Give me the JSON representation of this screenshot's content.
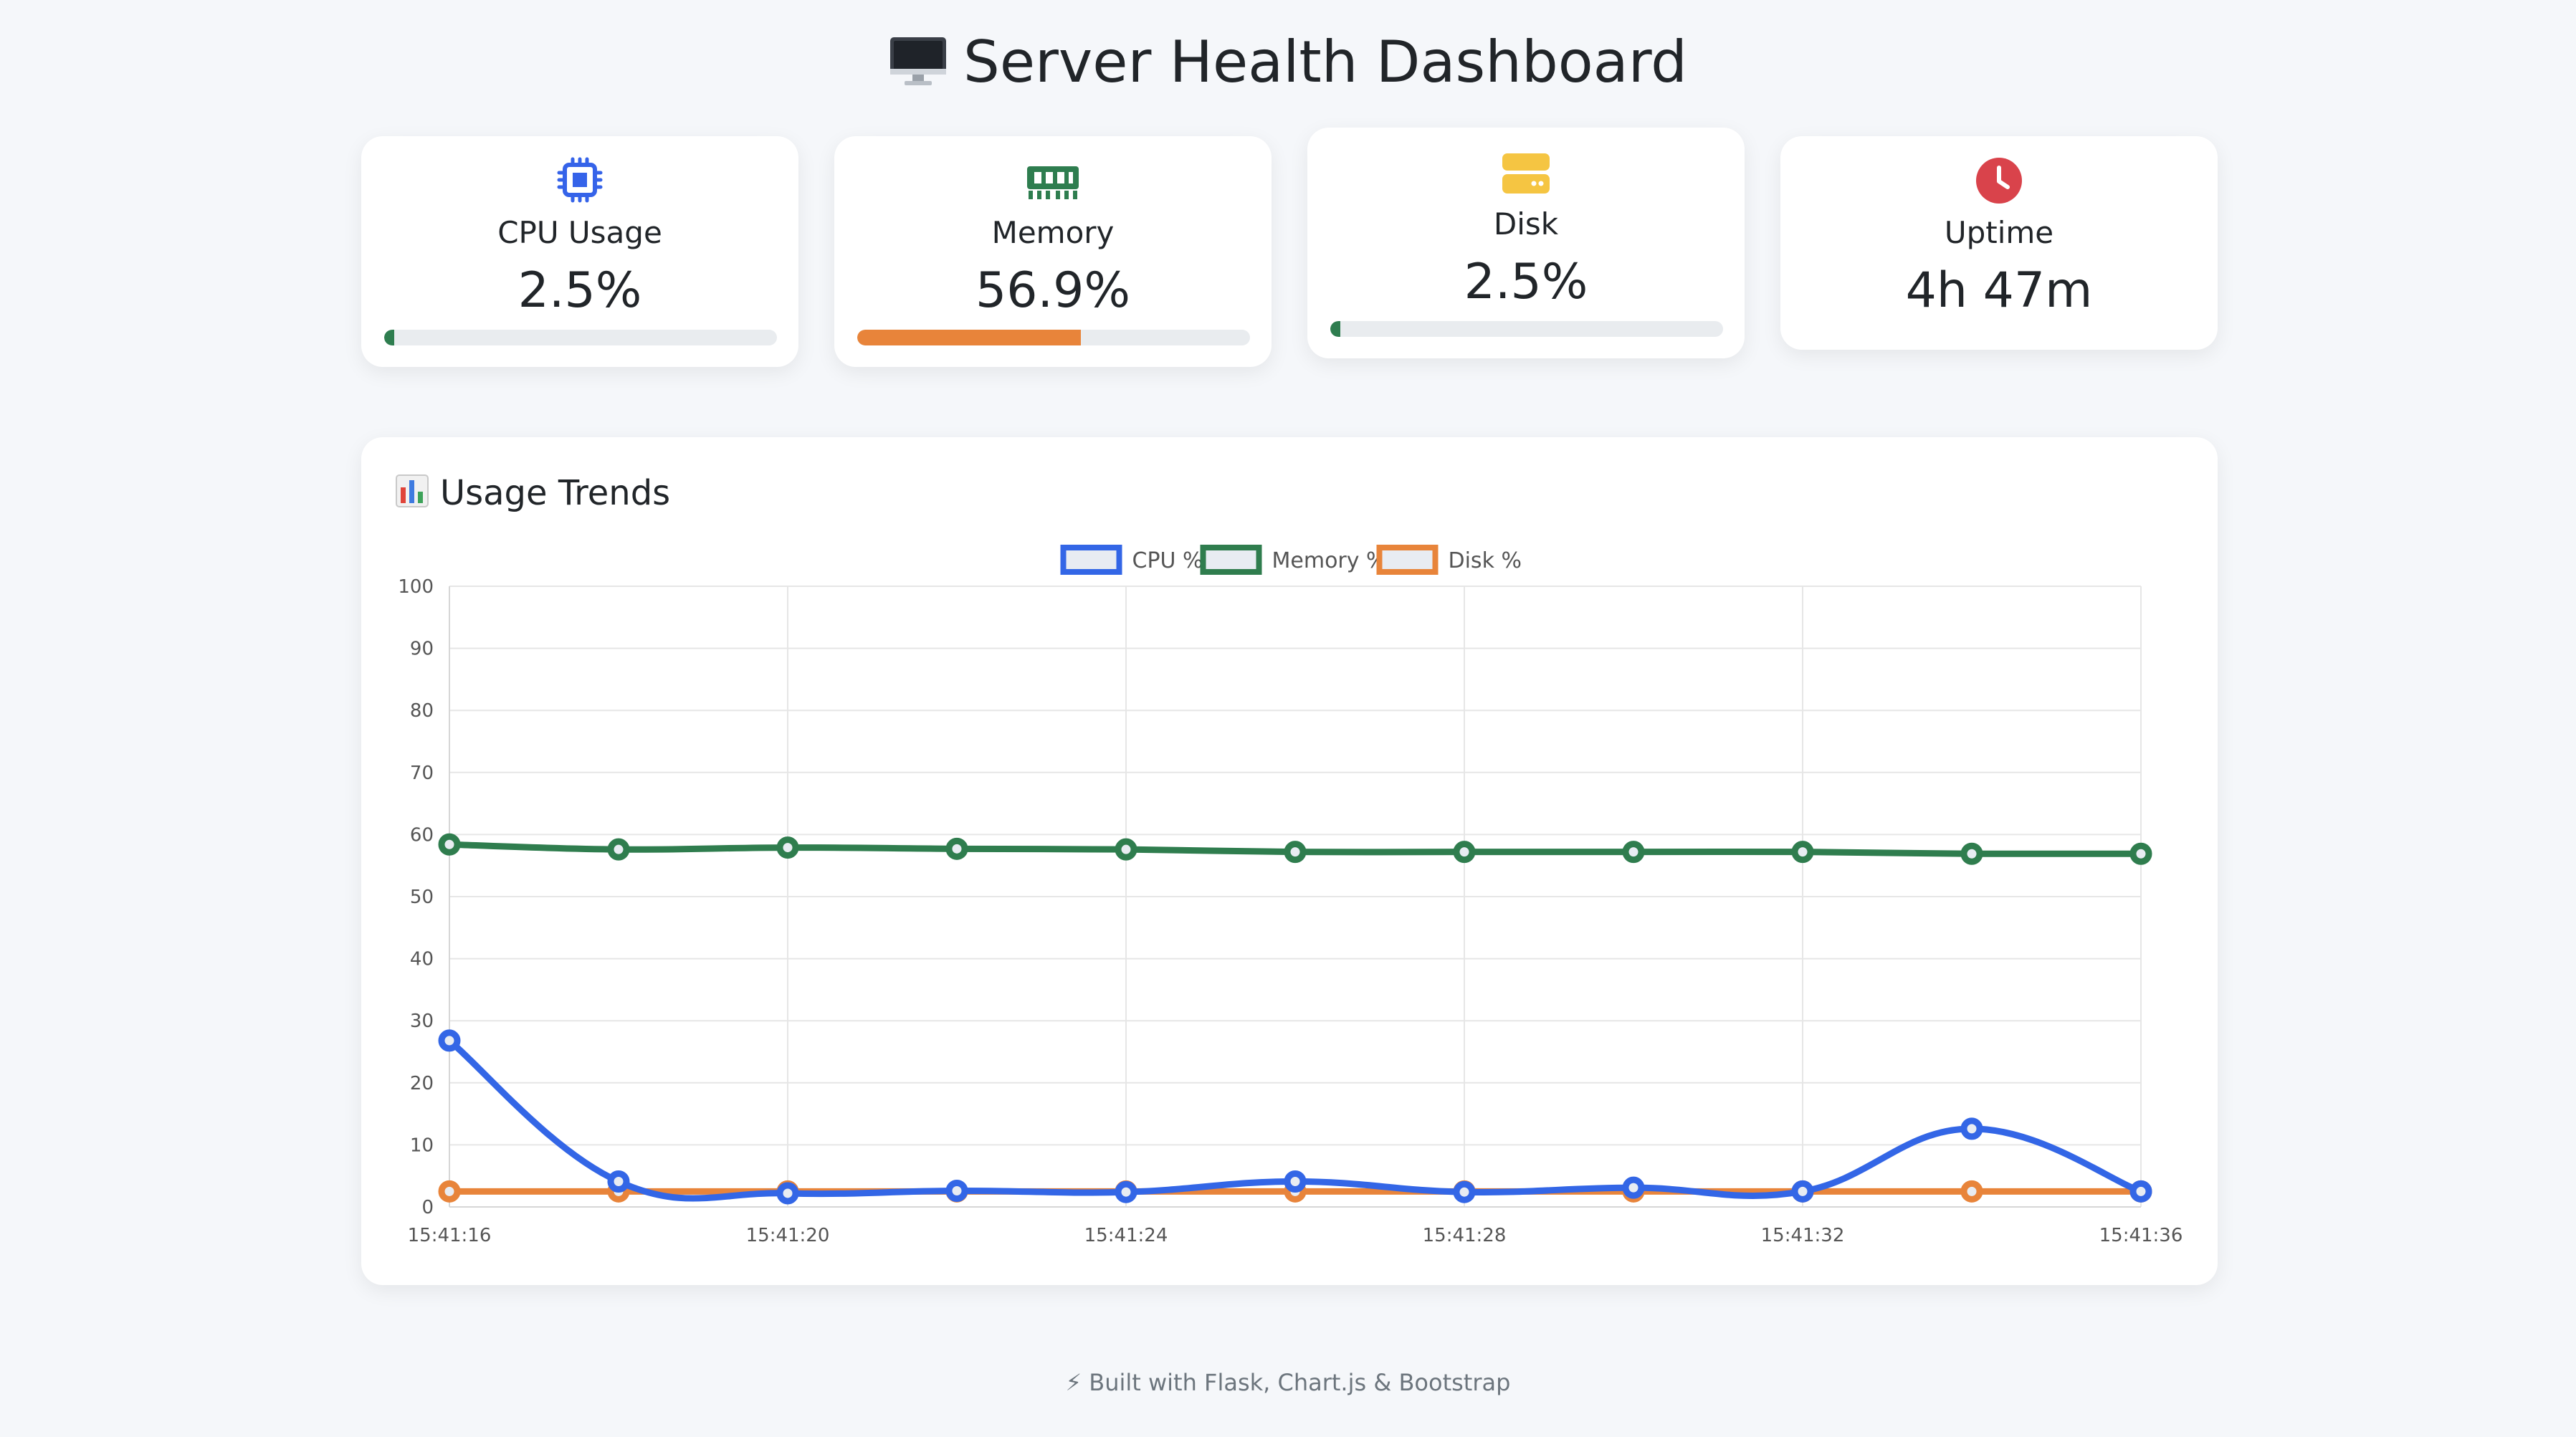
{
  "header": {
    "title": "Server Health Dashboard",
    "icon": "desktop-computer-icon"
  },
  "cards": {
    "cpu": {
      "label": "CPU Usage",
      "value": "2.5%",
      "percent": 2.5,
      "bar_color": "#2e7d4f",
      "icon": "cpu-chip-icon",
      "icon_color": "#3563e9"
    },
    "memory": {
      "label": "Memory",
      "value": "56.9%",
      "percent": 56.9,
      "bar_color": "#e8843a",
      "icon": "memory-ram-icon",
      "icon_color": "#2e7d4f"
    },
    "disk": {
      "label": "Disk",
      "value": "2.5%",
      "percent": 2.5,
      "bar_color": "#2e7d4f",
      "icon": "hard-drive-icon",
      "icon_color": "#f5c542"
    },
    "uptime": {
      "label": "Uptime",
      "value": "4h 47m",
      "icon": "clock-icon",
      "icon_color": "#d9434b"
    }
  },
  "trends": {
    "title": "Usage Trends",
    "icon": "bar-chart-icon"
  },
  "chart_data": {
    "type": "line",
    "x": [
      "15:41:16",
      "15:41:18",
      "15:41:20",
      "15:41:22",
      "15:41:24",
      "15:41:26",
      "15:41:28",
      "15:41:30",
      "15:41:32",
      "15:41:34",
      "15:41:36"
    ],
    "x_tick_labels": [
      "15:41:16",
      "15:41:20",
      "15:41:24",
      "15:41:28",
      "15:41:32",
      "15:41:36"
    ],
    "ylim": [
      0,
      100
    ],
    "y_ticks": [
      0,
      10,
      20,
      30,
      40,
      50,
      60,
      70,
      80,
      90,
      100
    ],
    "grid": true,
    "legend_position": "top-center",
    "series": [
      {
        "name": "CPU %",
        "color": "#3366e6",
        "values": [
          26.8,
          4.1,
          2.2,
          2.6,
          2.4,
          4.1,
          2.4,
          3.1,
          2.5,
          12.6,
          2.5
        ]
      },
      {
        "name": "Memory %",
        "color": "#2f7d4e",
        "values": [
          58.4,
          57.6,
          57.9,
          57.7,
          57.6,
          57.2,
          57.2,
          57.2,
          57.2,
          56.9,
          56.9
        ]
      },
      {
        "name": "Disk %",
        "color": "#e8843a",
        "values": [
          2.5,
          2.5,
          2.5,
          2.5,
          2.5,
          2.5,
          2.5,
          2.5,
          2.5,
          2.5,
          2.5
        ]
      }
    ]
  },
  "footer": {
    "text": "⚡ Built with Flask, Chart.js & Bootstrap"
  }
}
